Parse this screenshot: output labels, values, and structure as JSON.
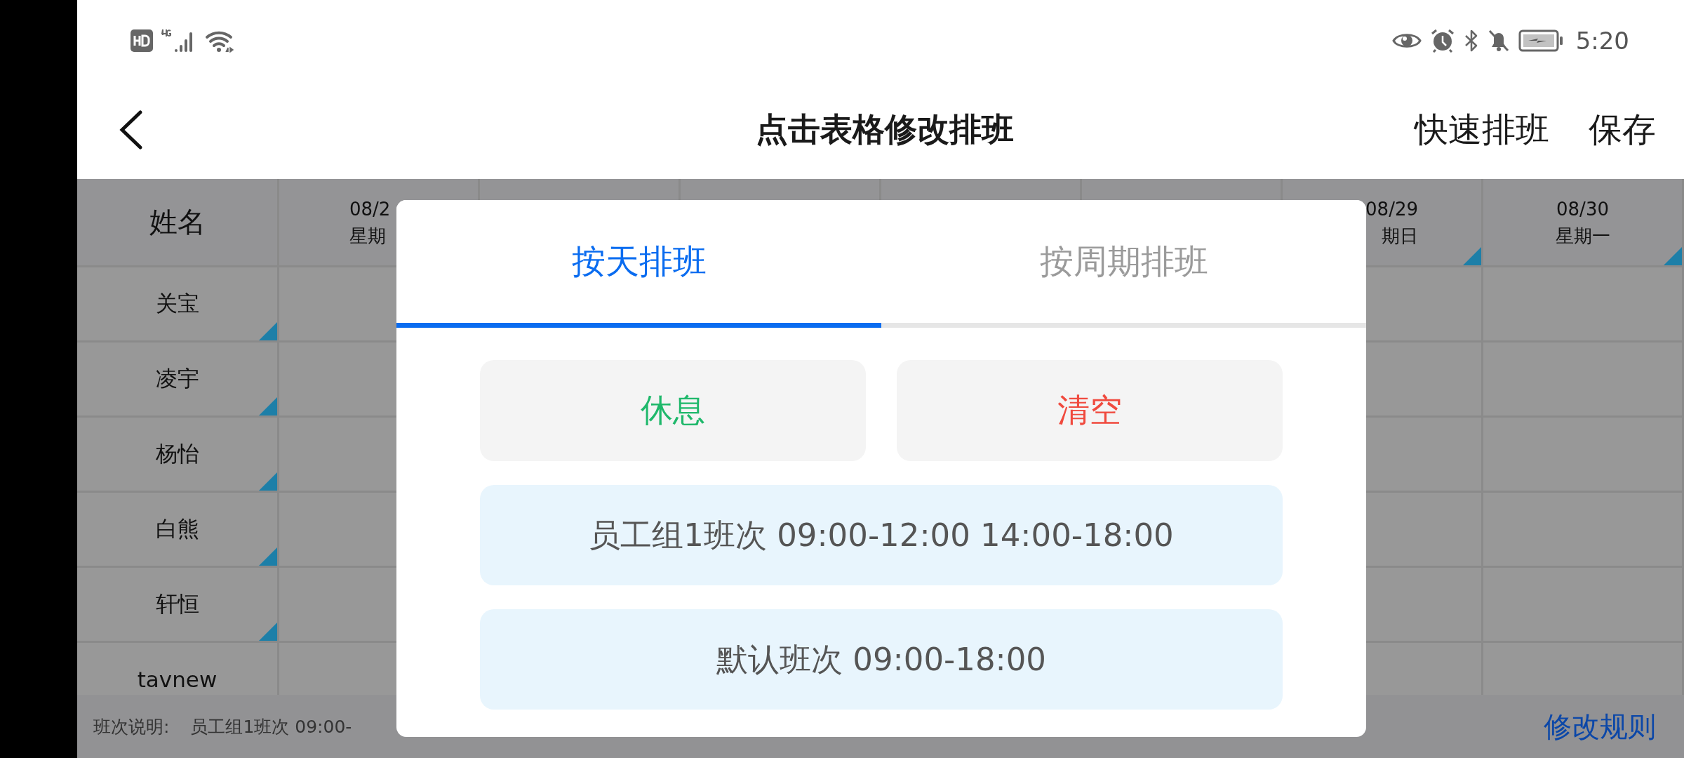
{
  "status_bar": {
    "time": "5:20"
  },
  "header": {
    "title": "点击表格修改排班",
    "actions": [
      "快速排班",
      "保存"
    ]
  },
  "table": {
    "name_header": "姓名",
    "columns": [
      {
        "date": "08/2",
        "weekday": "星期"
      },
      {},
      {},
      {},
      {},
      {
        "date": "08/29",
        "weekday": "期日",
        "flag": true
      },
      {
        "date": "08/30",
        "weekday": "星期一",
        "flag": true
      }
    ],
    "rows": [
      {
        "name": "关宝",
        "flag": true
      },
      {
        "name": "凌宇",
        "flag": true
      },
      {
        "name": "杨怡",
        "flag": true
      },
      {
        "name": "白熊",
        "flag": true
      },
      {
        "name": "轩恒",
        "flag": true
      },
      {
        "name": "tavnew"
      }
    ]
  },
  "footer": {
    "label": "班次说明:",
    "text": "员工组1班次 09:00-",
    "link": "修改规则"
  },
  "dialog": {
    "tabs": [
      {
        "label": "按天排班",
        "selected": true
      },
      {
        "label": "按周期排班",
        "selected": false
      }
    ],
    "quick_buttons": [
      {
        "label": "休息",
        "kind": "rest"
      },
      {
        "label": "清空",
        "kind": "clear"
      }
    ],
    "shifts": [
      "员工组1班次 09:00-12:00 14:00-18:00",
      "默认班次 09:00-18:00"
    ]
  }
}
